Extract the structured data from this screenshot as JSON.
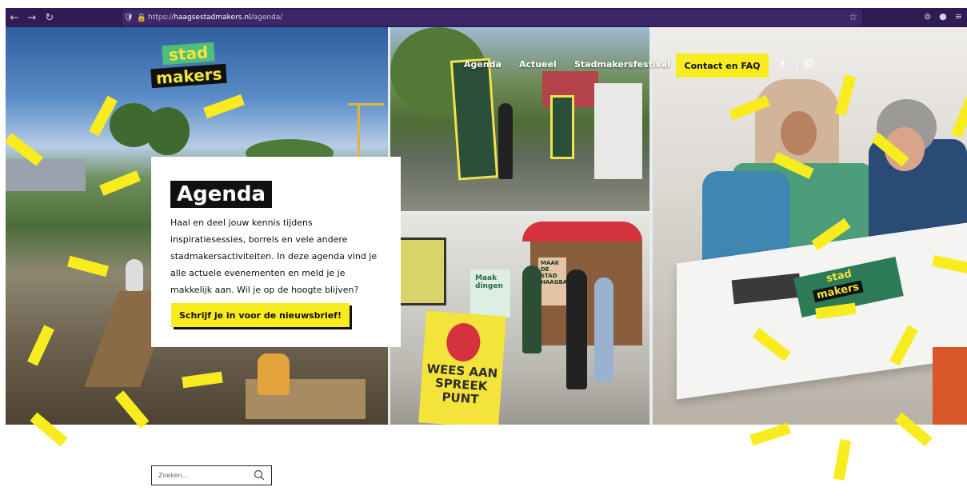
{
  "browser": {
    "url_prefix": "https://",
    "url_domain": "haagsestadmakers.nl",
    "url_path": "/agenda/"
  },
  "logo": {
    "line1": "stad",
    "line2": "makers"
  },
  "nav": {
    "items": [
      "Agenda",
      "Actueel",
      "Stadmakersfestival"
    ],
    "cta": "Contact en FAQ",
    "social": [
      "facebook-icon",
      "instagram-icon"
    ]
  },
  "hero": {
    "title": "Agenda",
    "description": "Haal en deel jouw kennis tijdens inspiratiesessies, borrels en vele andere stadmakersactiviteiten. In deze agenda vind je alle actuele evenementen en meld je je makkelijk aan. Wil je op de hoogte blijven?",
    "newsletter_button": "Schrijf je in voor de nieuwsbrief!",
    "photo_signs": {
      "board": "WEES AAN SPREEK PUNT",
      "green_board_lines": [
        "Maak",
        "dingen"
      ],
      "poster": "MAAK DE STAD HAAGBAAR",
      "table_poster_line1": "stad",
      "table_poster_line2": "makers"
    }
  },
  "search": {
    "placeholder": "Zoeken..."
  },
  "colors": {
    "brand_yellow": "#f8ec1f",
    "brand_green": "#4dbf78",
    "browser_purple": "#2f1c52",
    "text_black": "#111111"
  }
}
